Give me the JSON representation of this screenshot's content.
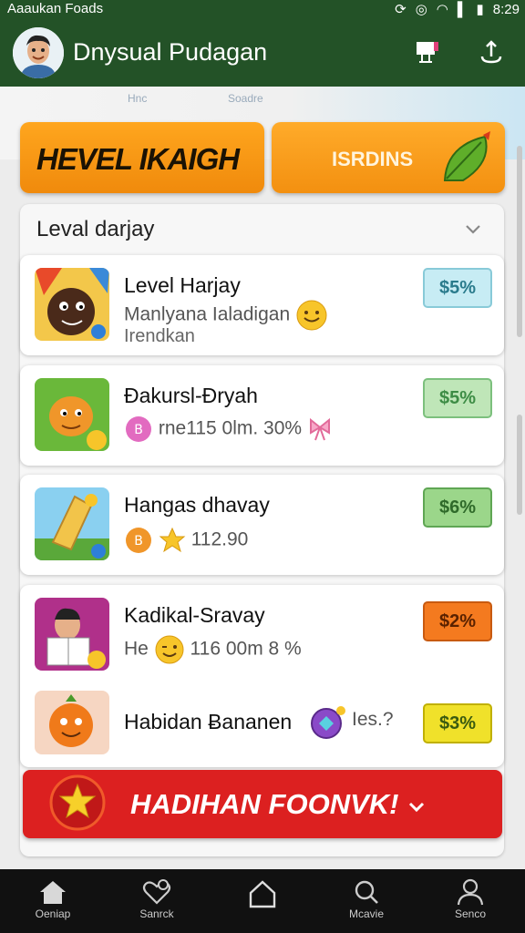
{
  "status": {
    "left_text": "Aaaukan Foads",
    "time": "8:29"
  },
  "header": {
    "title": "Dnysual Pudagan"
  },
  "background_labels": [
    "Hnc",
    "Soadre"
  ],
  "banners": {
    "left": "HEVEL IKAIGH",
    "right": "ISRDINS"
  },
  "section": {
    "title": "Leval darjay"
  },
  "items": [
    {
      "title": "Level Harjay",
      "subtitle": "Manlyana Ialadigan",
      "subtitle2": "Irendkan",
      "badge": "$5%",
      "badge_bg": "#c7ecf4",
      "badge_color": "#2a7b8c",
      "badge_border": "#88cad8"
    },
    {
      "title": "Ɖakursl-Ɖryah",
      "subtitle": "rne115 0lm. 30%",
      "badge": "$5%",
      "badge_bg": "#bfe6b8",
      "badge_color": "#3d8c45",
      "badge_border": "#7cc07d"
    },
    {
      "title": "Hangas dhavay",
      "subtitle": "112.90",
      "badge": "$6%",
      "badge_bg": "#9bd68a",
      "badge_color": "#2f6a2a",
      "badge_border": "#5fa654"
    },
    {
      "title": "Kadikal-Sravay",
      "subtitle": "He",
      "subtitle_tail": "116 00m 8 %",
      "badge": "$2%",
      "badge_bg": "#f47a1f",
      "badge_color": "#5a2200",
      "badge_border": "#c85a10"
    },
    {
      "title": "Habidan Ƀananen",
      "subtitle_tail": "Ies.?",
      "badge": "$3%",
      "badge_bg": "#f0e12a",
      "badge_color": "#3a5a10",
      "badge_border": "#c0b000"
    }
  ],
  "cta": {
    "label": "HADIHAN FOONVK!"
  },
  "nav": [
    {
      "label": "Oeniap",
      "icon": "home-icon"
    },
    {
      "label": "Sanrck",
      "icon": "heart-search-icon"
    },
    {
      "label": "",
      "icon": "house-outline-icon"
    },
    {
      "label": "Mcavie",
      "icon": "search-icon"
    },
    {
      "label": "Senco",
      "icon": "profile-icon"
    }
  ],
  "colors": {
    "appbar": "#235227",
    "banner_orange": "#f5951a",
    "cta_red": "#dc2020",
    "nav_bg": "#111111"
  }
}
